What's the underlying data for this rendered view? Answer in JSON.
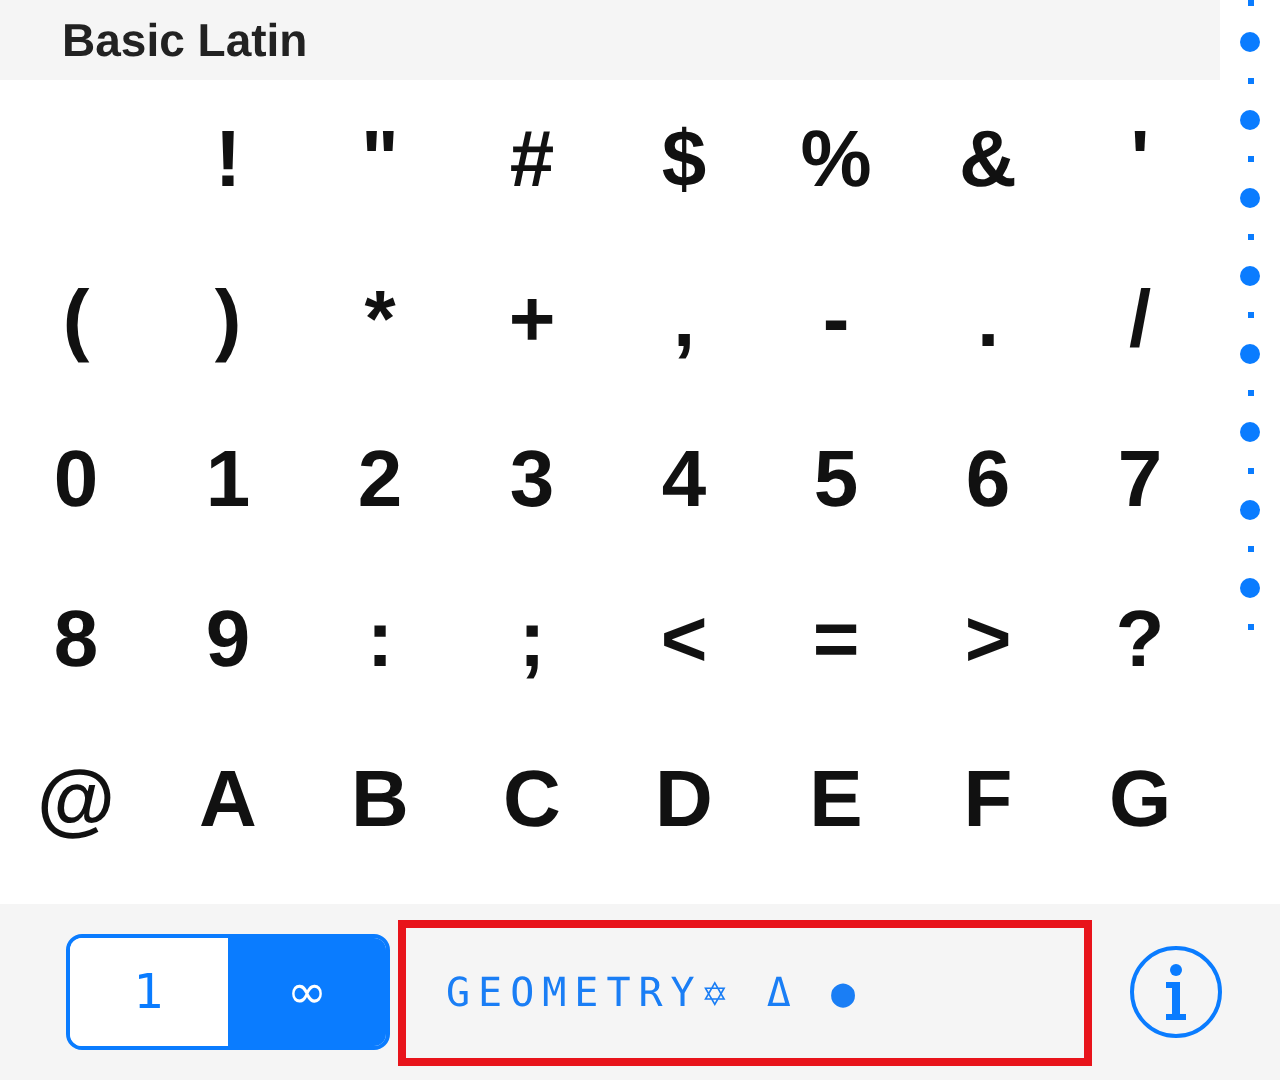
{
  "section": {
    "title": "Basic Latin"
  },
  "characters": [
    "!",
    "\"",
    "#",
    "$",
    "%",
    "&",
    "'",
    "(",
    ")",
    "*",
    "+",
    ",",
    "-",
    ".",
    "/",
    "0",
    "1",
    "2",
    "3",
    "4",
    "5",
    "6",
    "7",
    "8",
    "9",
    ":",
    ";",
    "<",
    "=",
    ">",
    "?",
    "@",
    "A",
    "B",
    "C",
    "D",
    "E",
    "F",
    "G"
  ],
  "segments": [
    {
      "label": "1",
      "selected": false
    },
    {
      "label": "∞",
      "selected": true
    }
  ],
  "font_name": {
    "value": "GEOMETRY✡ Δ ●",
    "highlighted": true
  }
}
